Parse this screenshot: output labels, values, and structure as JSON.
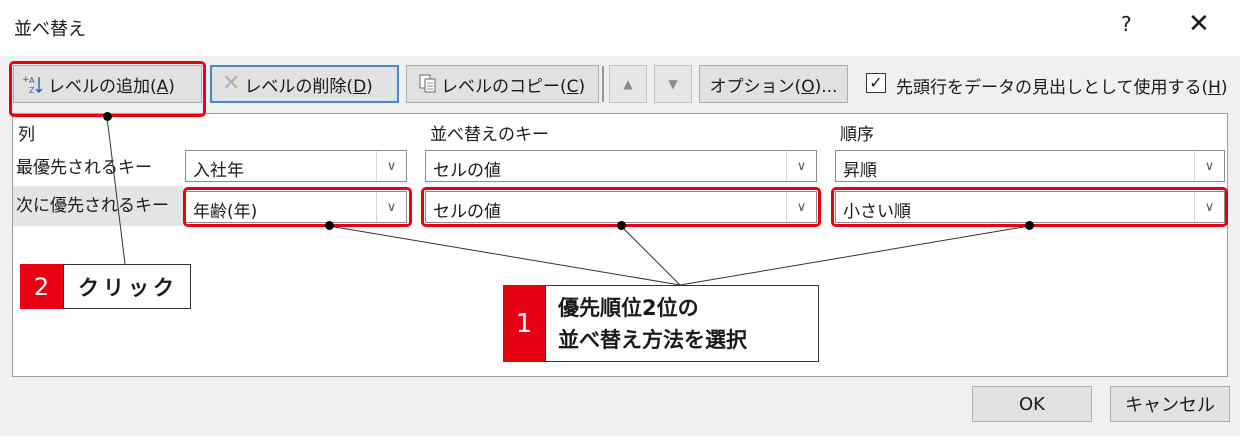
{
  "dialog": {
    "title": "並べ替え",
    "help_label": "?",
    "close_label": "✕"
  },
  "toolbar": {
    "add_level_prefix": "レベルの追加(",
    "add_level_key": "A",
    "add_level_suffix": ")",
    "delete_level_prefix": "レベルの削除(",
    "delete_level_key": "D",
    "delete_level_suffix": ")",
    "copy_level_prefix": "レベルのコピー(",
    "copy_level_key": "C",
    "copy_level_suffix": ")",
    "options_prefix": "オプション(",
    "options_key": "O",
    "options_suffix": ")...",
    "header_checkbox_prefix": "先頭行をデータの見出しとして使用する(",
    "header_checkbox_key": "H",
    "header_checkbox_suffix": ")",
    "header_checkbox_checked": true
  },
  "grid": {
    "col_header": "列",
    "sort_on_header": "並べ替えのキー",
    "order_header": "順序",
    "rows": [
      {
        "label": "最優先されるキー",
        "column": "入社年",
        "sort_on": "セルの値",
        "order": "昇順"
      },
      {
        "label": "次に優先されるキー",
        "column": "年齢(年)",
        "sort_on": "セルの値",
        "order": "小さい順"
      }
    ]
  },
  "annotations": {
    "callout2_number": "2",
    "callout2_text": "クリック",
    "callout1_number": "1",
    "callout1_line1": "優先順位2位の",
    "callout1_line2": "並べ替え方法を選択",
    "highlight_color": "#e60012"
  },
  "footer": {
    "ok_label": "OK",
    "cancel_label": "キャンセル"
  }
}
